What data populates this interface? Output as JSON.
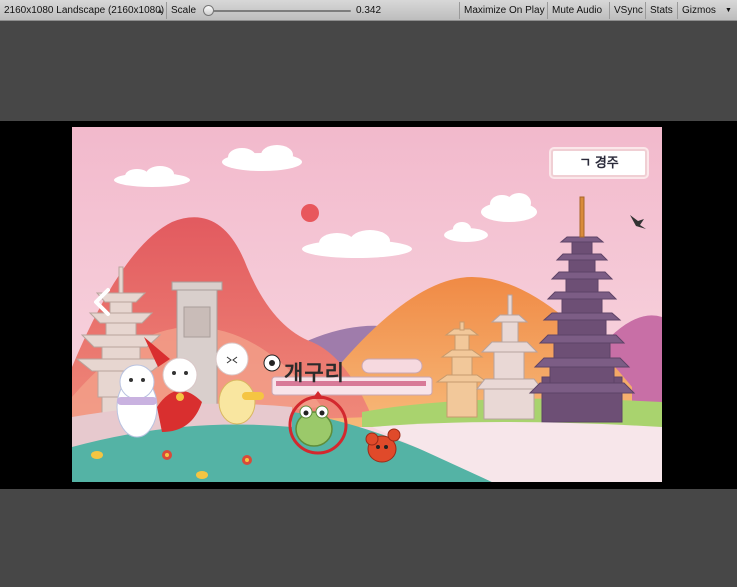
{
  "toolbar": {
    "resolution": "2160x1080 Landscape (2160x1080)",
    "scale_label": "Scale",
    "scale_value": "0.342",
    "scale_fraction": 0.03,
    "maximize_on_play": "Maximize On Play",
    "mute_audio": "Mute Audio",
    "vsync": "VSync",
    "stats": "Stats",
    "gizmos": "Gizmos"
  },
  "game": {
    "location_sign": "ㄱ 경주",
    "word": "개구리"
  },
  "icons": {
    "back": "chevron-left-icon",
    "dropdown": "dropdown-arrows-icon"
  },
  "colors": {
    "sky": "#f3c3d2",
    "accent": "#d3282e"
  }
}
